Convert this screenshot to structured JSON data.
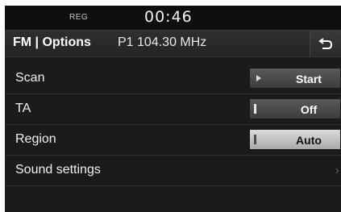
{
  "status": {
    "reg": "REG",
    "time": "00:46"
  },
  "header": {
    "title": "FM | Options",
    "preset": "P1",
    "frequency": "104.30 MHz",
    "back_icon": "back-arrow-icon"
  },
  "options": [
    {
      "label": "Scan",
      "control": "button",
      "value": "Start",
      "icon": "play-icon"
    },
    {
      "label": "TA",
      "control": "toggle",
      "value": "Off",
      "icon": "bar-icon"
    },
    {
      "label": "Region",
      "control": "toggle",
      "value": "Auto",
      "icon": "bar-icon",
      "active": true
    },
    {
      "label": "Sound settings",
      "control": "link",
      "icon": "chevron-right-icon"
    }
  ],
  "colors": {
    "background": "#1b1b1b",
    "active_button": "#c8c8c8"
  }
}
